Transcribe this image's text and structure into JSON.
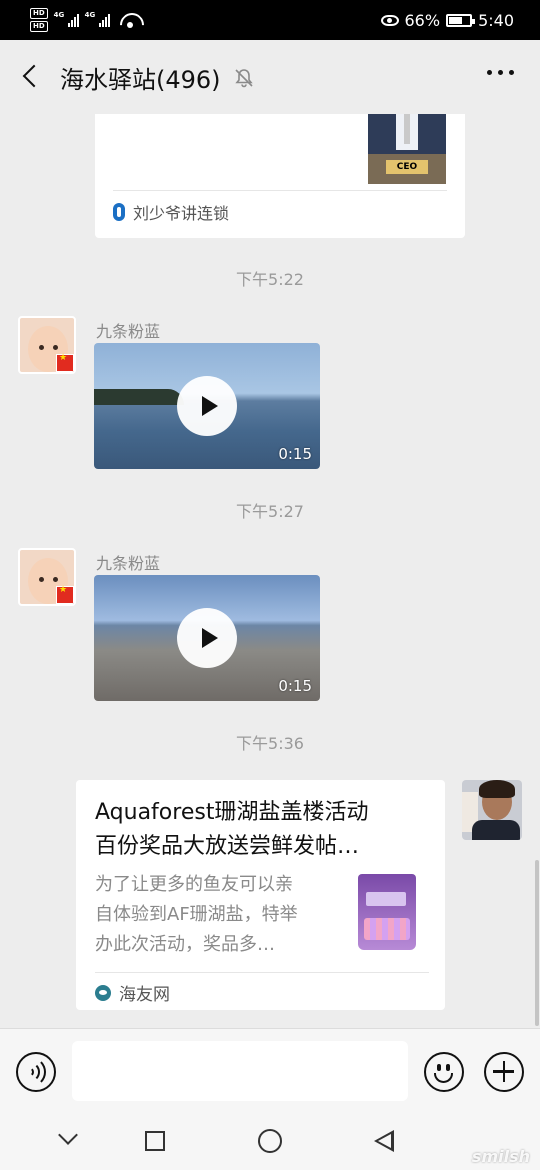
{
  "status_bar": {
    "net_1": "HD",
    "net_2": "HD",
    "signal_1": "4G",
    "signal_2": "4G",
    "battery_percent": "66%",
    "battery_level": 0.66,
    "time": "5:40",
    "icons": [
      "eye-icon",
      "wifi-icon",
      "battery-icon"
    ]
  },
  "header": {
    "title": "海水驿站(496)",
    "icons": [
      "back-icon",
      "mute-bell-icon",
      "more-icon"
    ]
  },
  "chat": {
    "top_card": {
      "thumb_text": "CEO",
      "source": "刘少爷讲连锁"
    },
    "messages": [
      {
        "time": "下午5:22",
        "sender": "九条粉蓝",
        "type": "video",
        "duration": "0:15"
      },
      {
        "time": "下午5:27",
        "sender": "九条粉蓝",
        "type": "video",
        "duration": "0:15"
      }
    ],
    "last_time": "下午5:36",
    "link_card": {
      "title_line1": "Aquaforest珊湖盐盖楼活动",
      "title_line2": "百份奖品大放送尝鲜发帖…",
      "desc_line1": "为了让更多的鱼友可以亲",
      "desc_line2": "自体验到AF珊湖盐，特举",
      "desc_line3": "办此次活动，奖品多…",
      "source": "海友网"
    }
  },
  "input_bar": {
    "input_value": "",
    "icons": [
      "voice-icon",
      "emoji-icon",
      "plus-icon"
    ]
  },
  "nav_bar": {
    "icons": [
      "nav-down-icon",
      "nav-recent-icon",
      "nav-home-icon",
      "nav-back-icon"
    ],
    "watermark": "smilsh"
  },
  "colors": {
    "background": "#ededed",
    "bubble": "#ffffff",
    "status_bar": "#000000",
    "muted_text": "#8a8a8a"
  }
}
